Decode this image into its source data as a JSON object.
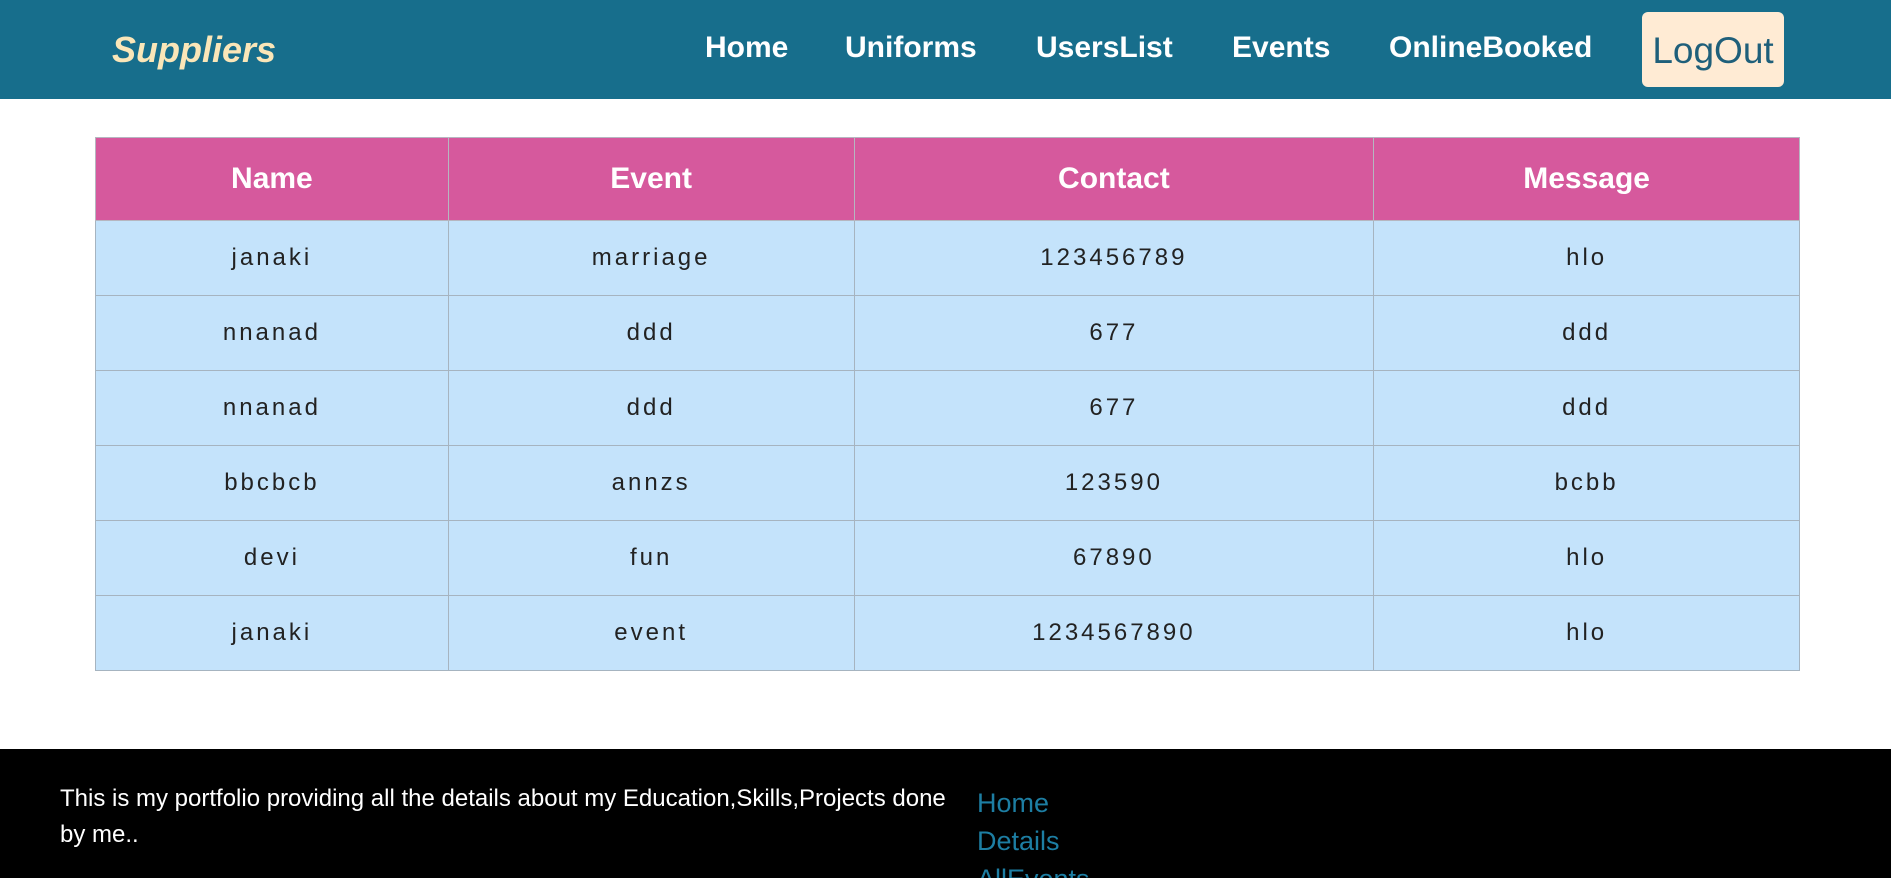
{
  "navbar": {
    "brand": "Suppliers",
    "links": [
      "Home",
      "Uniforms",
      "UsersList",
      "Events",
      "OnlineBooked"
    ],
    "logout": "LogOut"
  },
  "table": {
    "headers": [
      "Name",
      "Event",
      "Contact",
      "Message"
    ],
    "rows": [
      [
        "janaki",
        "marriage",
        "123456789",
        "hlo"
      ],
      [
        "nnanad",
        "ddd",
        "677",
        "ddd"
      ],
      [
        "nnanad",
        "ddd",
        "677",
        "ddd"
      ],
      [
        "bbcbcb",
        "annzs",
        "123590",
        "bcbb"
      ],
      [
        "devi",
        "fun",
        "67890",
        "hlo"
      ],
      [
        "janaki",
        "event",
        "1234567890",
        "hlo"
      ]
    ]
  },
  "footer": {
    "text": "This is my portfolio providing all the details about my Education,Skills,Projects done by me..",
    "links": [
      "Home",
      "Details",
      "AllEvents"
    ]
  }
}
